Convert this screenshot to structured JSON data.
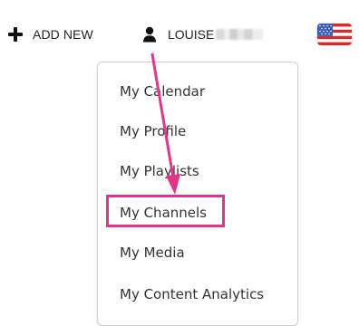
{
  "header": {
    "add_new_label": "ADD NEW",
    "user_name": "LOUISE",
    "plus_icon": "plus-icon",
    "user_icon": "user-icon",
    "flag_icon": "us-flag-icon"
  },
  "dropdown": {
    "items": [
      {
        "label": "My Calendar"
      },
      {
        "label": "My Profile"
      },
      {
        "label": "My Playlists"
      },
      {
        "label": "My Channels"
      },
      {
        "label": "My Media"
      },
      {
        "label": "My Content Analytics"
      }
    ]
  },
  "annotation": {
    "highlighted_item": "My Channels",
    "color": "#e5338a"
  },
  "colors": {
    "text": "#333333",
    "border": "#cfcfcf",
    "accent": "#e5338a",
    "flag_red": "#d62b2b",
    "flag_blue": "#3b5db5"
  }
}
